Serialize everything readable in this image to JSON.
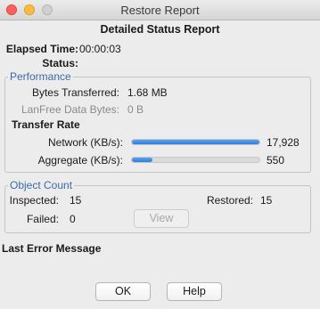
{
  "window": {
    "title": "Restore Report"
  },
  "report": {
    "heading": "Detailed Status Report",
    "elapsed_label": "Elapsed Time:",
    "elapsed_value": "00:00:03",
    "status_label": "Status:",
    "status_value": ""
  },
  "performance": {
    "legend": "Performance",
    "bytes_label": "Bytes Transferred:",
    "bytes_value": "1.68 MB",
    "lanfree_label": "LanFree Data Bytes:",
    "lanfree_value": "0  B",
    "transfer_rate_heading": "Transfer Rate",
    "network_label": "Network (KB/s):",
    "network_value": "17,928",
    "network_level": 1.0,
    "aggregate_label": "Aggregate (KB/s):",
    "aggregate_value": "550",
    "aggregate_level": 0.16
  },
  "object_count": {
    "legend": "Object Count",
    "inspected_label": "Inspected:",
    "inspected_value": "15",
    "restored_label": "Restored:",
    "restored_value": "15",
    "failed_label": "Failed:",
    "failed_value": "0",
    "view_button": "View"
  },
  "last_error": {
    "heading": "Last Error Message",
    "message": ""
  },
  "buttons": {
    "ok": "OK",
    "help": "Help"
  }
}
